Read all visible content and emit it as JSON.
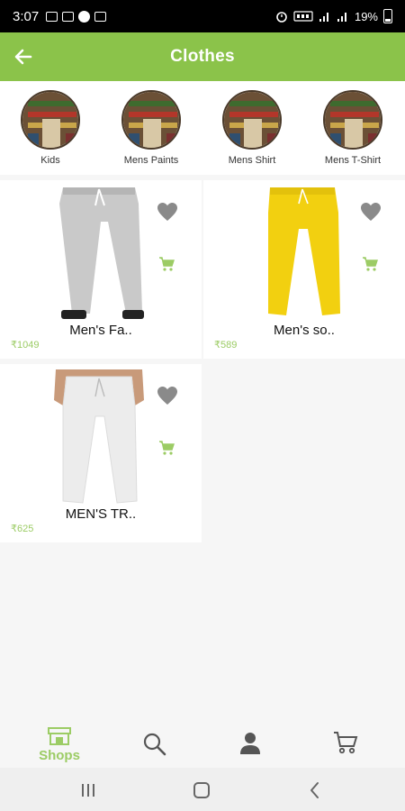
{
  "status_bar": {
    "time": "3:07",
    "battery": "19%"
  },
  "header": {
    "title": "Clothes"
  },
  "categories": [
    {
      "label": "Kids"
    },
    {
      "label": "Mens Paints"
    },
    {
      "label": "Mens Shirt"
    },
    {
      "label": "Mens T-Shirt"
    }
  ],
  "products": [
    {
      "name": "Men's Fa..",
      "price": "₹1049",
      "color": "#c9c9c9"
    },
    {
      "name": "Men's so..",
      "price": "₹589",
      "color": "#f2d010"
    },
    {
      "name": "MEN'S TR..",
      "price": "₹625",
      "color": "#ececec"
    }
  ],
  "bottom_nav": {
    "shops_label": "Shops"
  },
  "colors": {
    "accent": "#8bc34a",
    "price": "#9ccc65",
    "icon_gray": "#8a8a8a"
  }
}
